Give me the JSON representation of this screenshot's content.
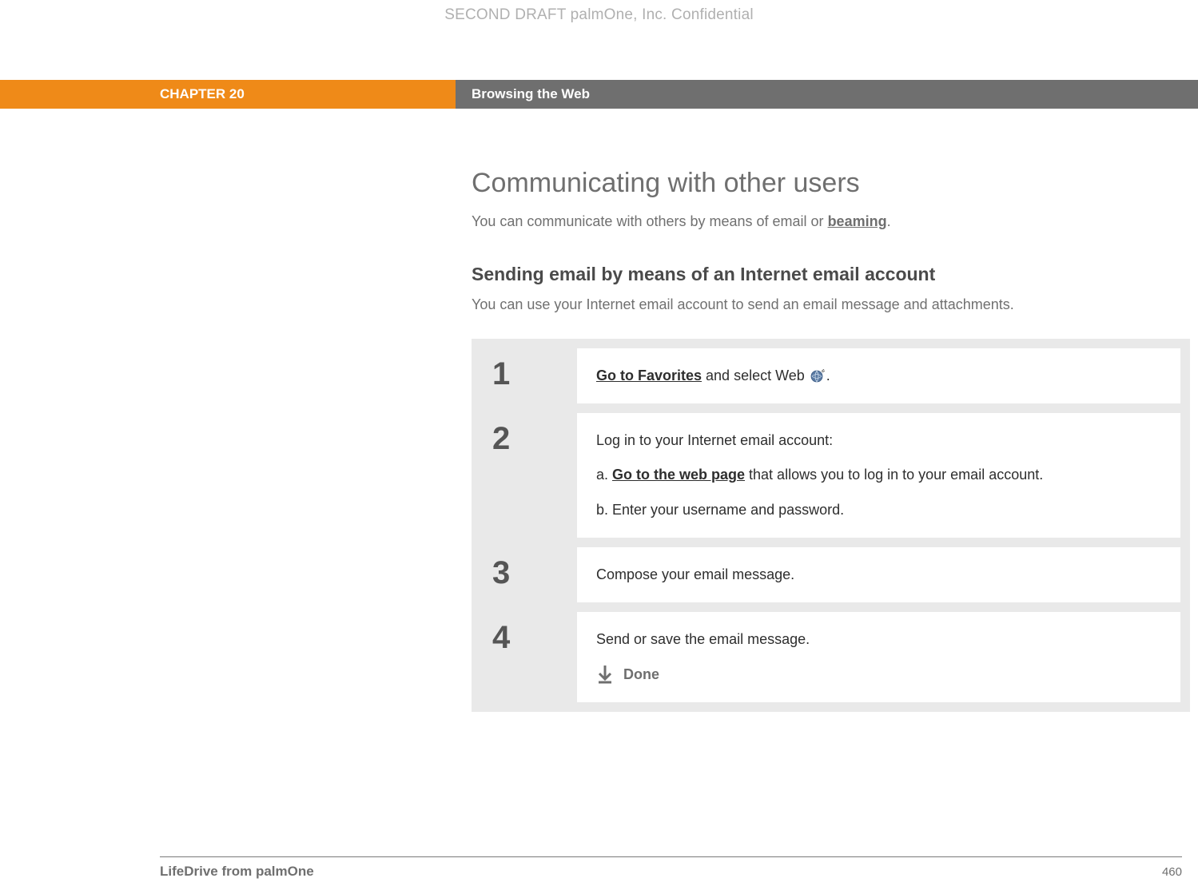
{
  "watermark": "SECOND DRAFT palmOne, Inc.  Confidential",
  "header": {
    "chapter": "CHAPTER 20",
    "title": "Browsing the Web"
  },
  "content": {
    "section_title": "Communicating with other users",
    "intro_pre": "You can communicate with others by means of email or ",
    "intro_link": "beaming",
    "intro_post": ".",
    "sub_title": "Sending email by means of an Internet email account",
    "sub_desc": "You can use your Internet email account to send an email message and attachments."
  },
  "steps": [
    {
      "num": "1",
      "link": "Go to Favorites",
      "text_post": " and select Web ",
      "text_end": "."
    },
    {
      "num": "2",
      "lead": "Log in to your Internet email account:",
      "a_pre": "a.  ",
      "a_link": "Go to the web page",
      "a_post": " that allows you to log in to your email account.",
      "b": "b.  Enter your username and password."
    },
    {
      "num": "3",
      "text": "Compose your email message."
    },
    {
      "num": "4",
      "text": "Send or save the email message.",
      "done": "Done"
    }
  ],
  "footer": {
    "left": "LifeDrive from palmOne",
    "page": "460"
  }
}
